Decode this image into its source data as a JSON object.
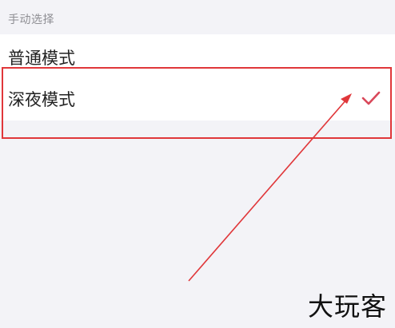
{
  "section": {
    "header": "手动选择"
  },
  "modes": [
    {
      "label": "普通模式",
      "selected": false
    },
    {
      "label": "深夜模式",
      "selected": true
    }
  ],
  "icons": {
    "selected_mark": "checkmark-icon"
  },
  "annotation": {
    "highlight_color": "#e0373a",
    "arrow_color": "#e0373a"
  },
  "watermark": {
    "text": "大玩客"
  }
}
